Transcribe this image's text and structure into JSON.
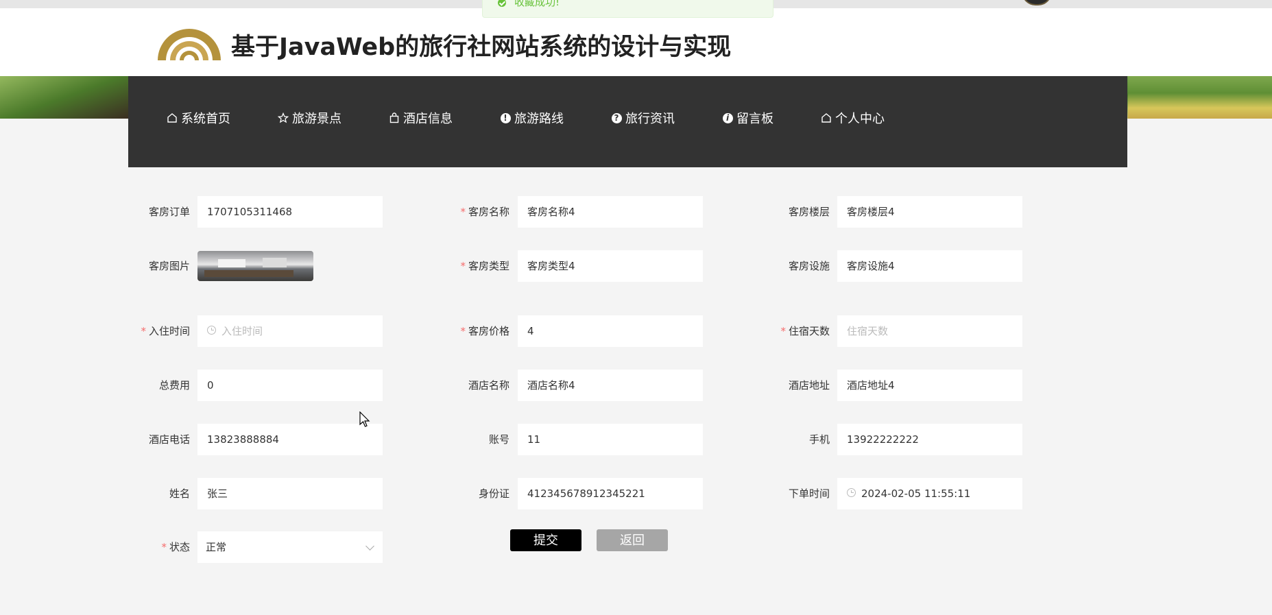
{
  "toast": {
    "message": "收藏成功!"
  },
  "header": {
    "title": "基于JavaWeb的旅行社网站系统的设计与实现"
  },
  "nav": {
    "items": [
      {
        "label": "系统首页",
        "icon": "home-icon"
      },
      {
        "label": "旅游景点",
        "icon": "star-icon"
      },
      {
        "label": "酒店信息",
        "icon": "bag-icon"
      },
      {
        "label": "旅游路线",
        "icon": "info-icon"
      },
      {
        "label": "旅行资讯",
        "icon": "question-icon"
      },
      {
        "label": "留言板",
        "icon": "info-i-icon"
      },
      {
        "label": "个人中心",
        "icon": "home-icon"
      }
    ]
  },
  "form": {
    "order_no": {
      "label": "客房订单",
      "value": "1707105311468"
    },
    "room_name": {
      "label": "客房名称",
      "value": "客房名称4",
      "required": true
    },
    "room_floor": {
      "label": "客房楼层",
      "value": "客房楼层4"
    },
    "room_image": {
      "label": "客房图片"
    },
    "room_type": {
      "label": "客房类型",
      "value": "客房类型4",
      "required": true
    },
    "room_facility": {
      "label": "客房设施",
      "value": "客房设施4"
    },
    "checkin_time": {
      "label": "入住时间",
      "placeholder": "入住时间",
      "required": true
    },
    "room_price": {
      "label": "客房价格",
      "value": "4",
      "required": true
    },
    "stay_days": {
      "label": "住宿天数",
      "placeholder": "住宿天数",
      "required": true
    },
    "total_cost": {
      "label": "总费用",
      "value": "0"
    },
    "hotel_name": {
      "label": "酒店名称",
      "value": "酒店名称4"
    },
    "hotel_address": {
      "label": "酒店地址",
      "value": "酒店地址4"
    },
    "hotel_phone": {
      "label": "酒店电话",
      "value": "13823888884"
    },
    "account": {
      "label": "账号",
      "value": "11"
    },
    "mobile": {
      "label": "手机",
      "value": "13922222222"
    },
    "name": {
      "label": "姓名",
      "value": "张三"
    },
    "id_card": {
      "label": "身份证",
      "value": "412345678912345221"
    },
    "order_time": {
      "label": "下单时间",
      "value": "2024-02-05 11:55:11"
    },
    "status": {
      "label": "状态",
      "value": "正常",
      "required": true
    }
  },
  "buttons": {
    "submit": "提交",
    "back": "返回"
  },
  "colors": {
    "nav_bg": "#333333",
    "success": "#67c23a",
    "required": "#f56c6c"
  }
}
